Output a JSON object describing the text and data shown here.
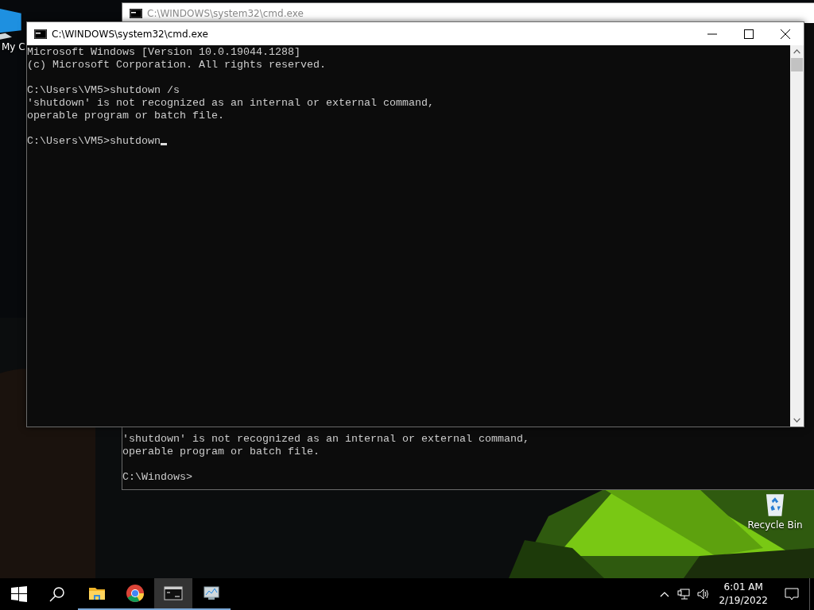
{
  "desktop": {
    "icons": [
      {
        "kind": "computer",
        "label": "My C"
      },
      {
        "kind": "recycle",
        "label": "Recycle Bin"
      }
    ]
  },
  "windows": [
    {
      "title": "C:\\WINDOWS\\system32\\cmd.exe",
      "active": false,
      "cursor": false,
      "blocks": [
        [
          "'shutdown' is not recognized as an internal or external command,",
          "operable program or batch file."
        ],
        [
          "C:\\Windows>"
        ]
      ]
    },
    {
      "title": "C:\\WINDOWS\\system32\\cmd.exe",
      "active": true,
      "cursor": true,
      "blocks": [
        [
          "Microsoft Windows [Version 10.0.19044.1288]",
          "(c) Microsoft Corporation. All rights reserved."
        ],
        [
          "C:\\Users\\VM5>shutdown /s",
          "'shutdown' is not recognized as an internal or external command,",
          "operable program or batch file."
        ],
        [
          "C:\\Users\\VM5>shutdown"
        ]
      ]
    }
  ],
  "taskbar": {
    "items": [
      {
        "kind": "start",
        "selected": false,
        "running": false
      },
      {
        "kind": "search",
        "selected": false,
        "running": false
      },
      {
        "kind": "folder",
        "selected": false,
        "running": true
      },
      {
        "kind": "browser",
        "selected": false,
        "running": true
      },
      {
        "kind": "terminal",
        "selected": true,
        "running": true
      },
      {
        "kind": "monitor",
        "selected": false,
        "running": true
      }
    ],
    "tray": {
      "time": "6:01 AM",
      "date": "2/19/2022"
    }
  }
}
